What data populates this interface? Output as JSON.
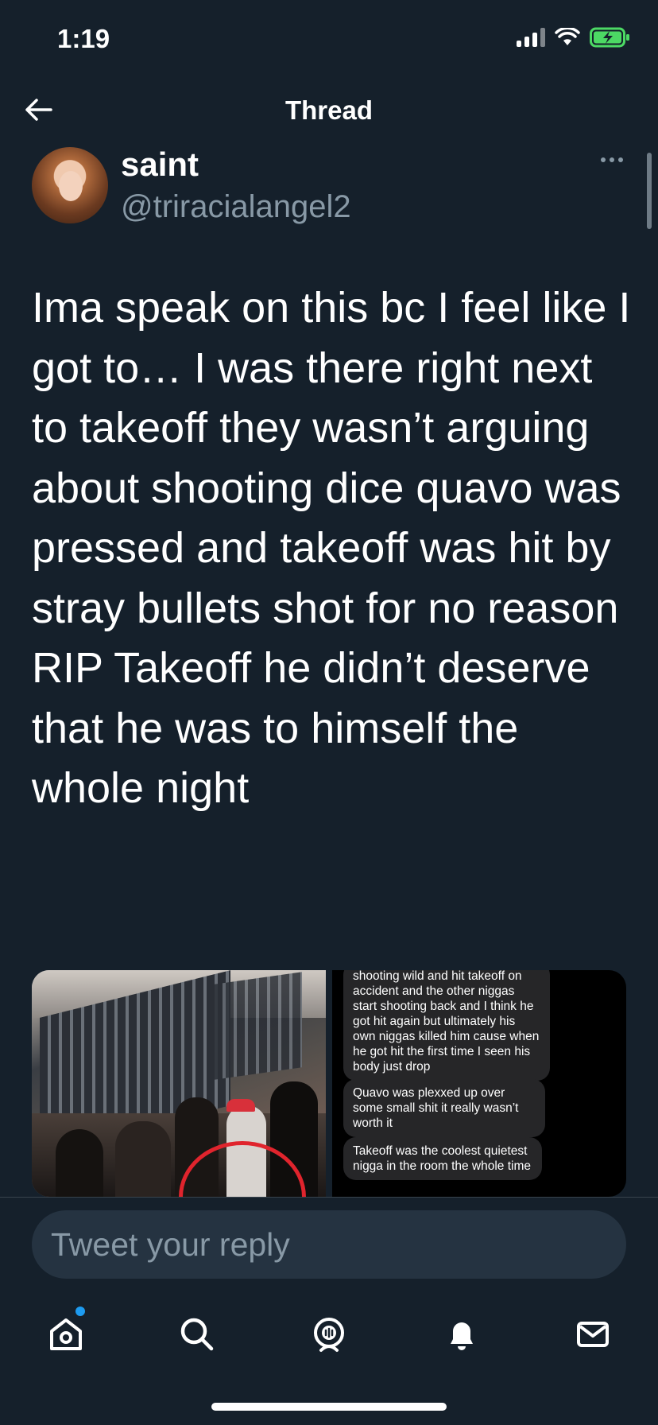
{
  "status_bar": {
    "time": "1:19"
  },
  "header": {
    "title": "Thread"
  },
  "tweet": {
    "display_name": "saint",
    "handle": "@triracialangel2",
    "text": "Ima speak on this bc I feel like I got to… I was there right next to takeoff they wasn’t arguing about shooting dice quavo was pressed and takeoff was hit by stray bullets shot for no reason\nRIP Takeoff he didn’t deserve that he was to himself the whole night"
  },
  "media": {
    "chat_bubbles": [
      "shooting wild and hit takeoff on accident and the other niggas start shooting back and I think he got hit again but ultimately his own niggas killed him cause when he got hit the first time I seen his body just drop",
      "Quavo was plexxed up over some small shit it really wasn’t worth it",
      "Takeoff was the coolest quietest nigga in the room the whole time"
    ]
  },
  "reply": {
    "placeholder": "Tweet your reply"
  },
  "tabs": [
    "home-icon",
    "search-icon",
    "spaces-icon",
    "notifications-icon",
    "messages-icon"
  ],
  "colors": {
    "background": "#15202b",
    "secondary_text": "#8899a6",
    "accent": "#1d9bf0",
    "battery": "#4cd964"
  }
}
